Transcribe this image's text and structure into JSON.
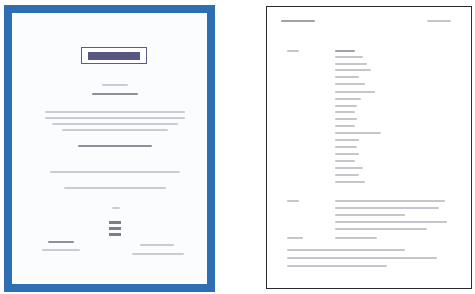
{
  "thumbnails": [
    {
      "kind": "certificate",
      "border_color": "#2e6fb3"
    },
    {
      "kind": "document",
      "border_color": "#2b2b2b"
    }
  ],
  "colors": {
    "certificate_frame": "#2e6fb3",
    "page_background": "#ffffff",
    "text_placeholder": "#c4c6cb"
  }
}
